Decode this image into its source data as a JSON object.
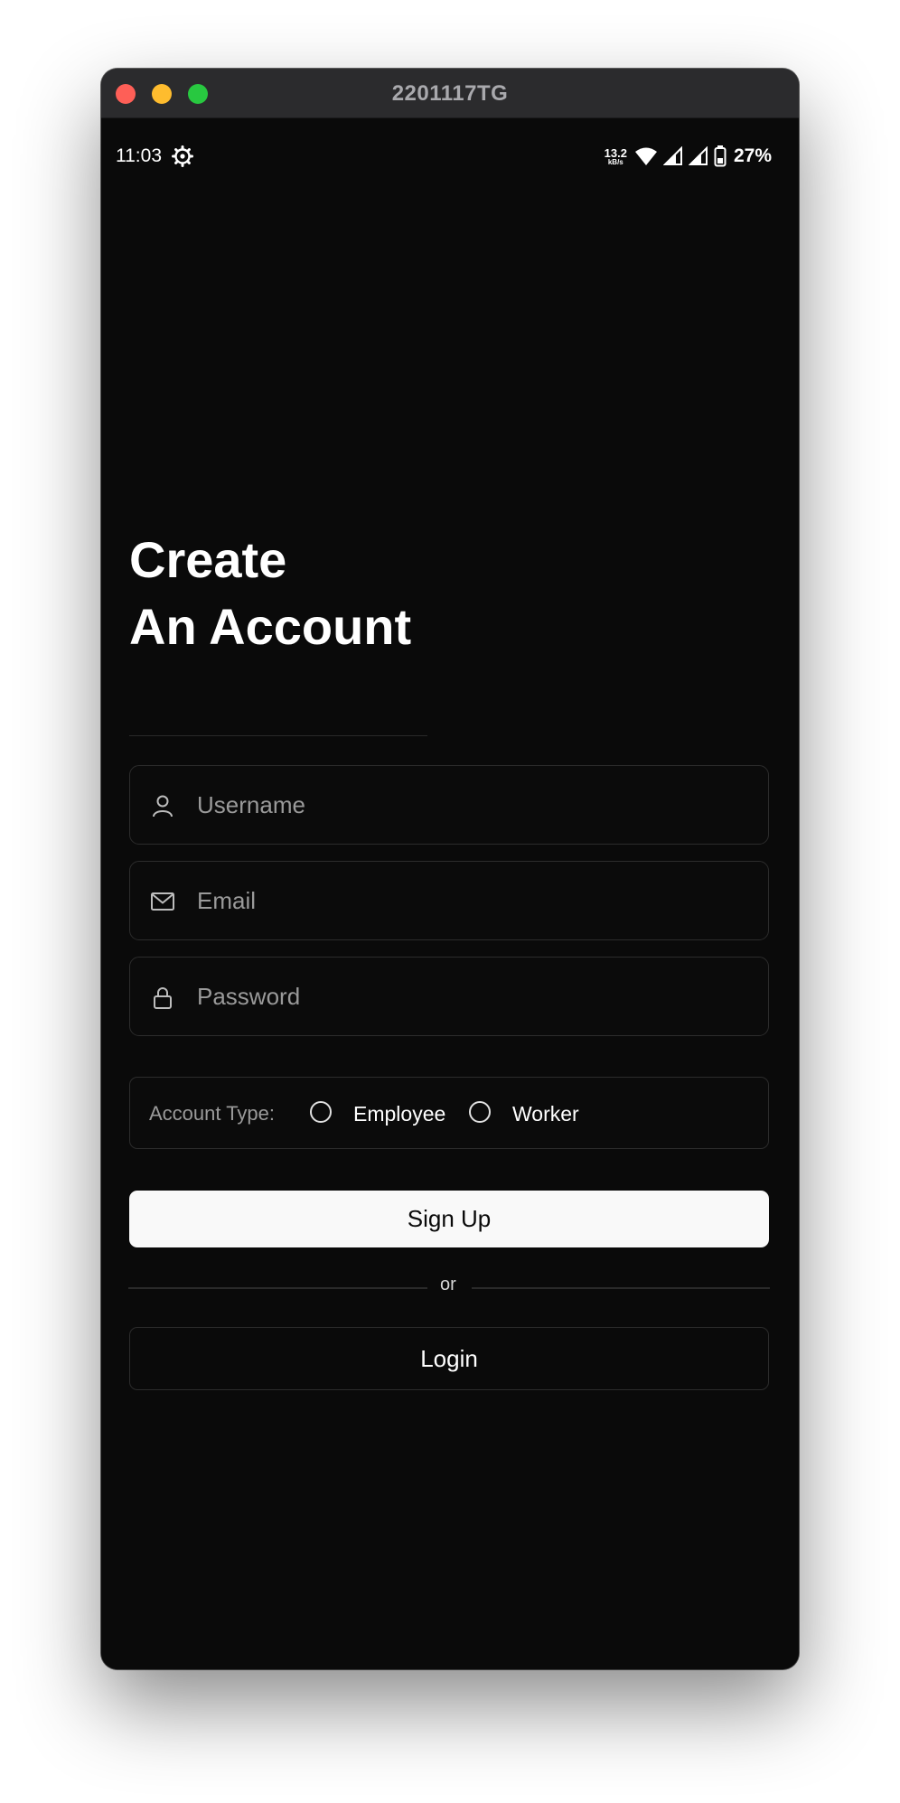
{
  "window": {
    "title": "2201117TG"
  },
  "status_bar": {
    "time": "11:03",
    "net_speed_value": "13.2",
    "net_speed_unit": "kB/s",
    "battery_percent": "27%"
  },
  "heading": {
    "line1": "Create",
    "line2": "An Account"
  },
  "form": {
    "username": {
      "placeholder": "Username",
      "value": ""
    },
    "email": {
      "placeholder": "Email",
      "value": ""
    },
    "password": {
      "placeholder": "Password",
      "value": ""
    }
  },
  "account_type": {
    "label": "Account Type:",
    "options": [
      "Employee",
      "Worker"
    ]
  },
  "buttons": {
    "signup": "Sign Up",
    "divider": "or",
    "login": "Login"
  },
  "colors": {
    "background": "#0a0a0a",
    "primary_button": "#f9f9f9",
    "border": "#2c2c2c",
    "placeholder": "#9a9a9a"
  }
}
